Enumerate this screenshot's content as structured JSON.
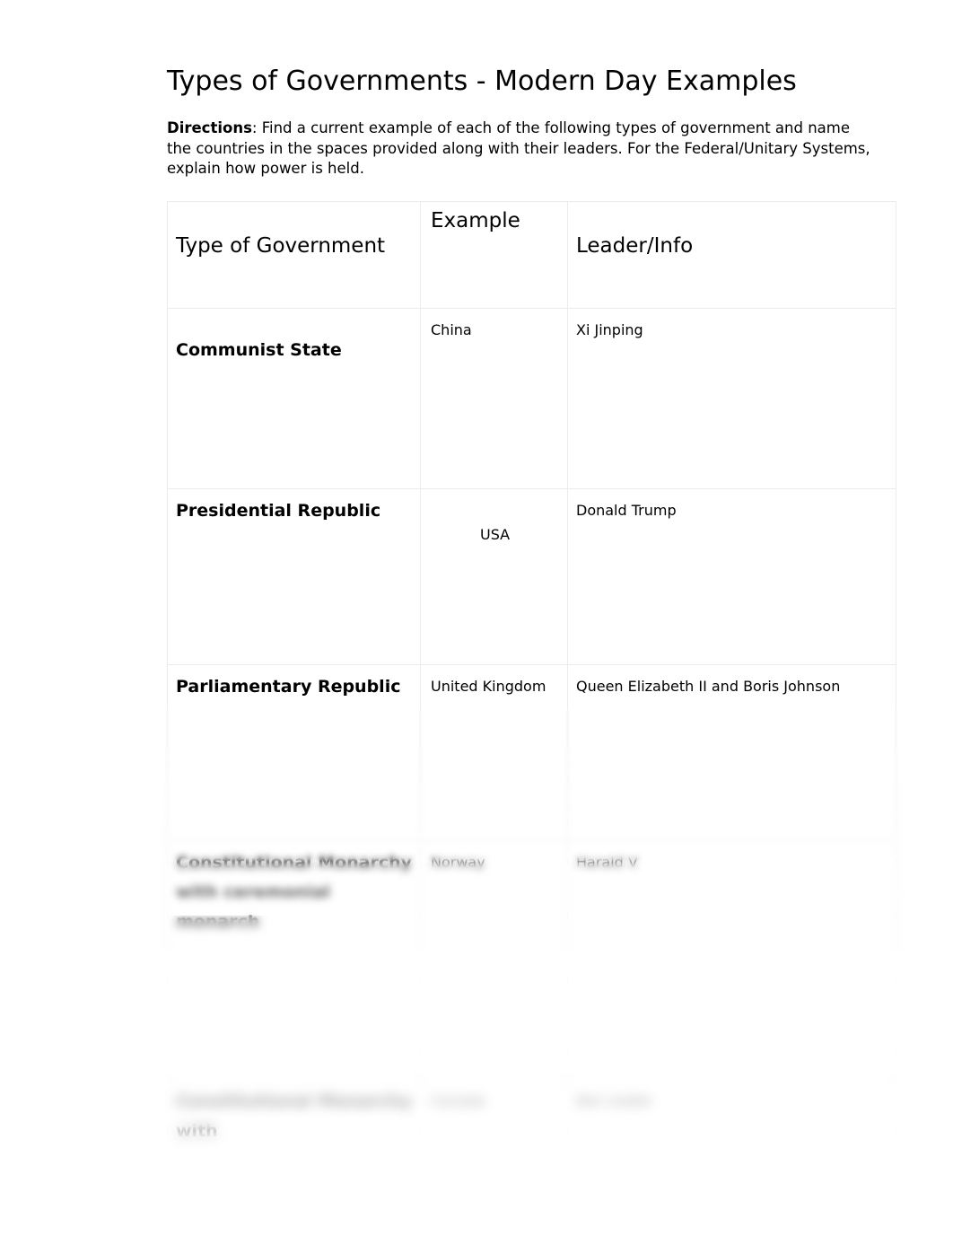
{
  "document": {
    "title": "Types of Governments - Modern Day Examples",
    "directions_label": "Directions",
    "directions_text": ": Find a current example of each of the following types of government and name the countries in the spaces provided along with their leaders. For the Federal/Unitary Systems, explain how power is held."
  },
  "table": {
    "headers": {
      "type_of_government": "Type of Government",
      "example": "Example",
      "leader_info": "Leader/Info"
    },
    "rows": [
      {
        "type": "Communist State",
        "example": "China",
        "leader": "Xi Jinping"
      },
      {
        "type": "Presidential Republic",
        "example": "USA",
        "leader": "Donald Trump"
      },
      {
        "type": "Parliamentary Republic",
        "example": "United Kingdom",
        "leader": "Queen Elizabeth II and Boris Johnson"
      },
      {
        "type": "Constitutional Monarchy with ceremonial monarch",
        "example": "Norway",
        "leader": "Harald V"
      },
      {
        "type": "Constitutional Monarchy with",
        "example": "Canada",
        "leader": "Not visible"
      }
    ]
  },
  "colors": {
    "page_background": "#ffffff",
    "text": "#000000",
    "table_border": "#ececec"
  }
}
